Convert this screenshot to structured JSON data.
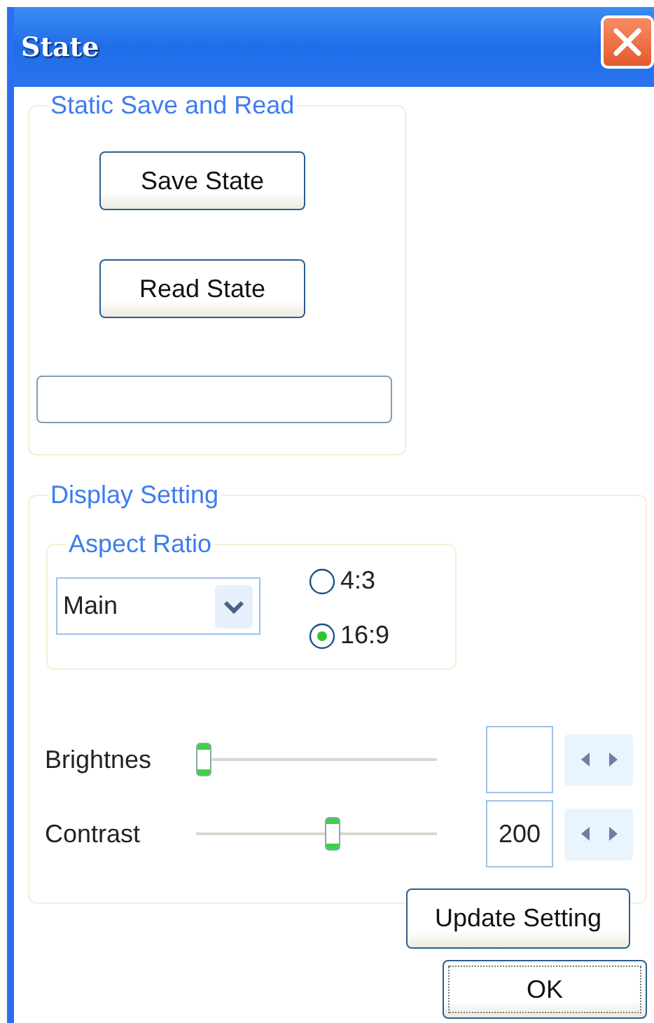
{
  "window": {
    "title": "State"
  },
  "save_read": {
    "title": "Static Save and Read",
    "buttons": [
      "Save State",
      "Read State"
    ]
  },
  "display": {
    "title": "Display Setting",
    "aspect_ratio": {
      "title": "Aspect Ratio",
      "dropdown": "Main",
      "options": [
        {
          "label": "4:3",
          "selected": false
        },
        {
          "label": "16:9",
          "selected": true
        }
      ]
    },
    "sliders": [
      {
        "label": "Brightnes",
        "level": 0
      },
      {
        "label": "Contrast",
        "level": 0.57,
        "value": "200"
      }
    ],
    "update_button": "Update Setting"
  },
  "ok_button": "OK"
}
